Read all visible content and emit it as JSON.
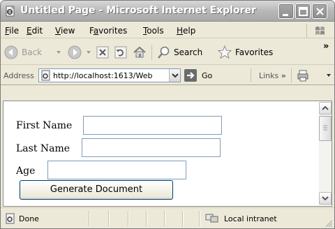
{
  "window": {
    "title": "Untitled Page - Microsoft Internet Explorer"
  },
  "menu": {
    "items": [
      {
        "label": "File",
        "accel": "F",
        "rest": "ile"
      },
      {
        "label": "Edit",
        "accel": "E",
        "rest": "dit"
      },
      {
        "label": "View",
        "accel": "V",
        "rest": "iew"
      },
      {
        "label": "Favorites",
        "pre": "F",
        "accel": "a",
        "rest": "vorites"
      },
      {
        "label": "Tools",
        "accel": "T",
        "rest": "ools"
      },
      {
        "label": "Help",
        "accel": "H",
        "rest": "elp"
      }
    ]
  },
  "toolbar": {
    "back_label": "Back",
    "search_label": "Search",
    "favorites_label": "Favorites",
    "more_glyph": "»"
  },
  "address": {
    "label": "Address",
    "url": "http://localhost:1613/Web",
    "go_label": "Go",
    "links_label": "Links",
    "links_more": "»"
  },
  "form": {
    "first_name_label": "First Name",
    "first_name_value": "",
    "last_name_label": "Last Name",
    "last_name_value": "",
    "age_label": "Age",
    "age_value": "",
    "generate_button": "Generate Document"
  },
  "status": {
    "text": "Done",
    "zone": "Local intranet"
  },
  "icons": {
    "page": "ie-page-icon",
    "back": "back-arrow-icon",
    "forward": "forward-arrow-icon",
    "stop": "stop-icon",
    "refresh": "refresh-icon",
    "home": "home-icon",
    "search": "search-icon",
    "favorites": "star-icon",
    "go": "go-arrow-icon",
    "print": "printer-icon",
    "zone": "intranet-icon"
  }
}
